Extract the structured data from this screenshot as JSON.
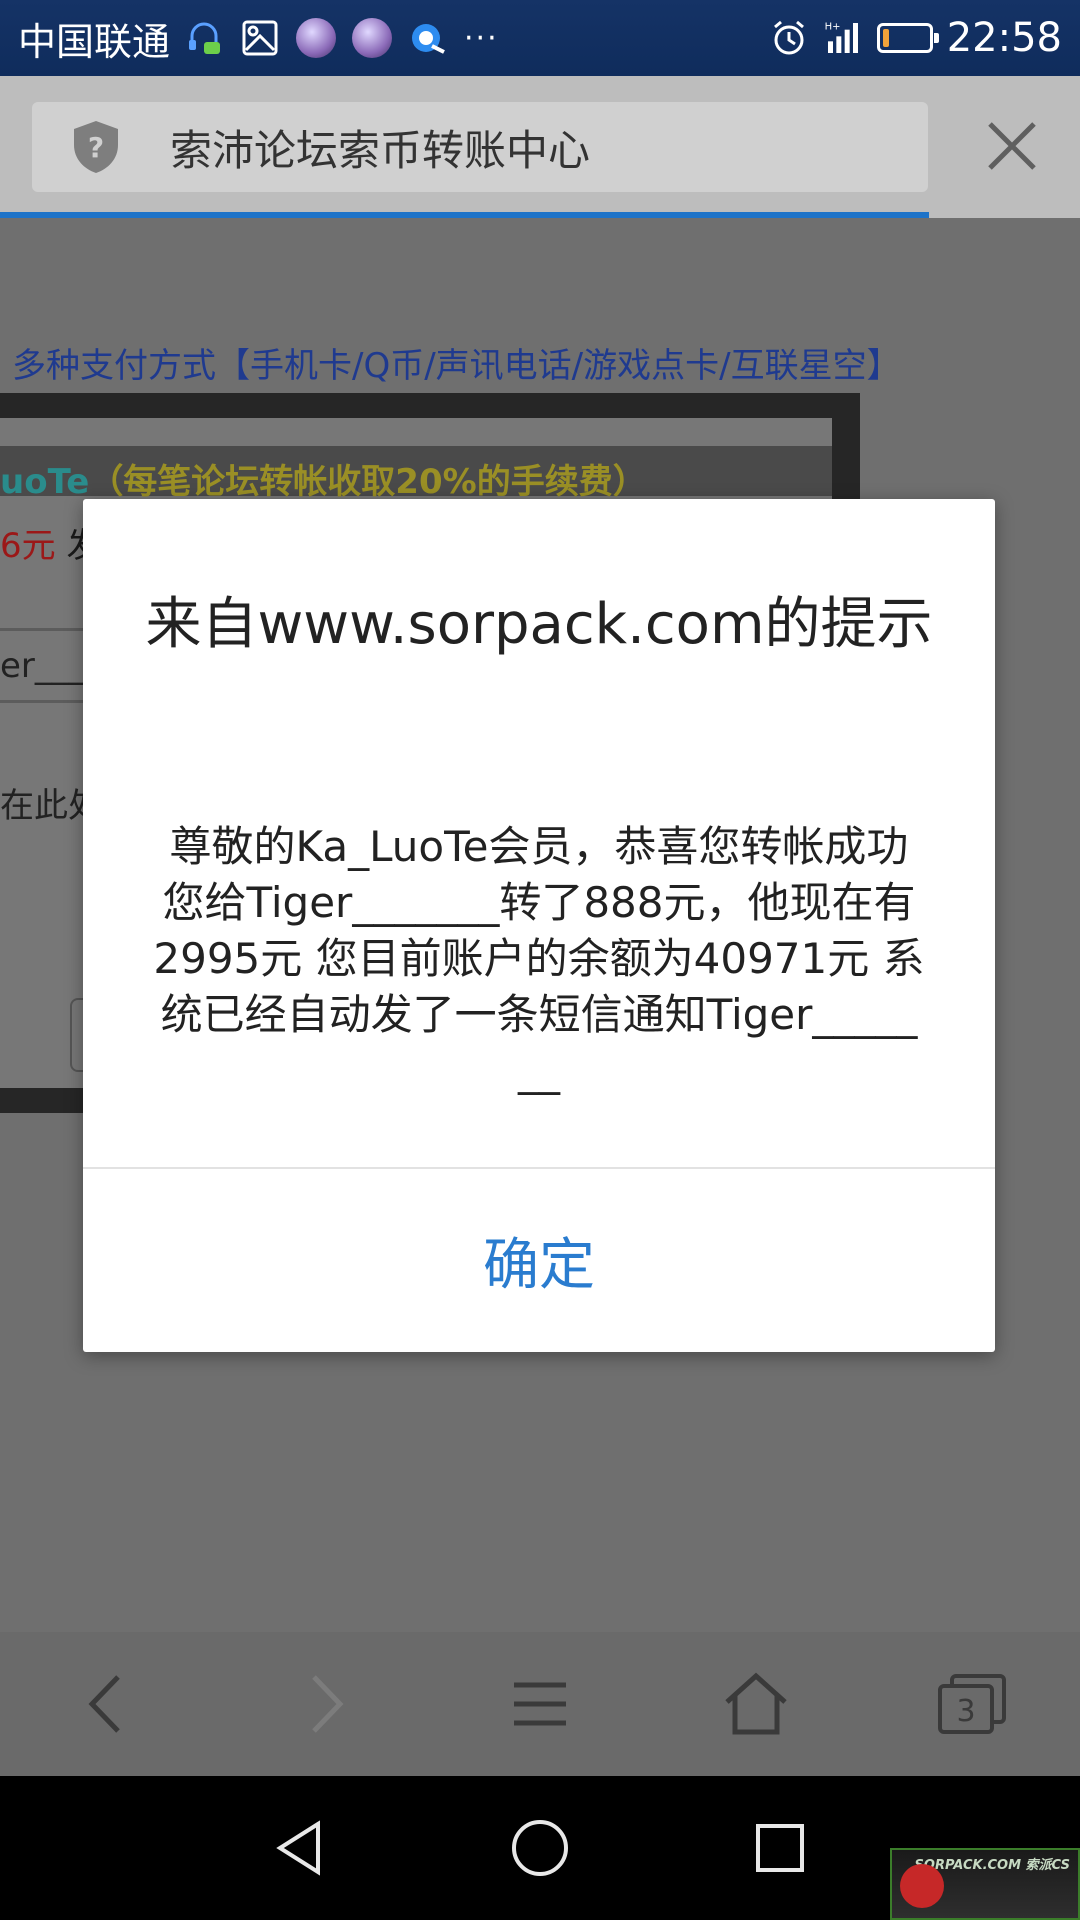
{
  "status_bar": {
    "carrier": "中国联通",
    "more": "···",
    "time": "22:58",
    "battery_level": 0.15,
    "battery_color": "#f1a33a"
  },
  "browser": {
    "page_title": "索沛论坛索币转账中心",
    "load_progress": 0.86,
    "accent": "#1e73c8"
  },
  "page": {
    "pay_link": "多种支付方式【手机卡/Q币/声讯电话/游戏点卡/互联星空】",
    "fee_user": "uoTe",
    "fee_note": "（每笔论坛转帐收取20%的手续费）",
    "price_red": "6元",
    "price_black": "发",
    "fragment_er": "er___",
    "fragment_here": "在此处"
  },
  "dialog": {
    "title": "来自www.sorpack.com的提示",
    "message": "尊敬的Ka_LuoTe会员，恭喜您转帐成功  您给Tiger_______转了888元，他现在有2995元  您目前账户的余额为40971元  系统已经自动发了一条短信通知Tiger_______",
    "ok_label": "确定",
    "ok_color": "#2a7ccf"
  },
  "toolbar": {
    "tabs_count": "3"
  },
  "watermark": {
    "text": "SORPACK.COM 索派CS"
  }
}
